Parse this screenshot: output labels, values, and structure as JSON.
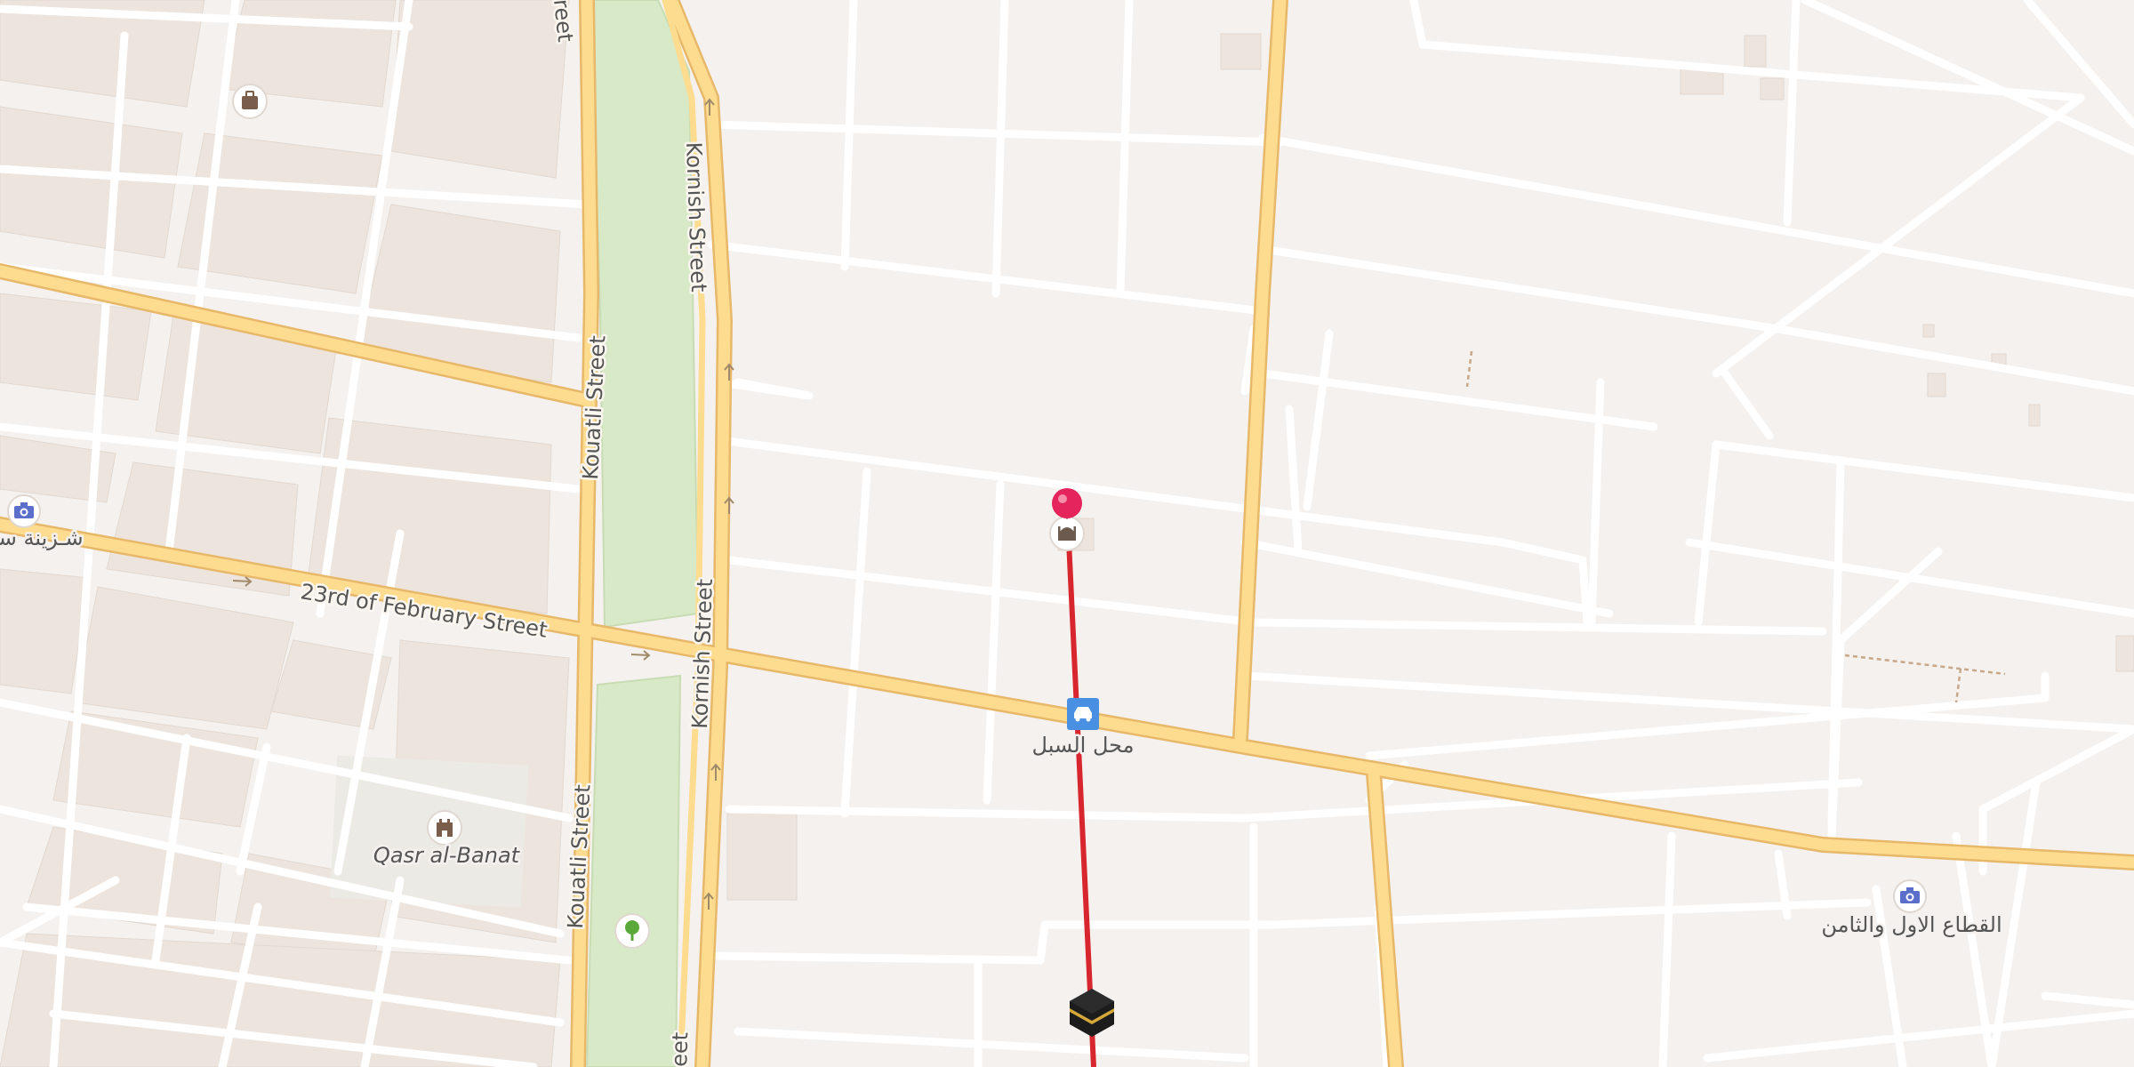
{
  "map": {
    "streets": {
      "kornish_upper": "Kornish Street",
      "kornish_lower": "Kornish Street",
      "kornish_bottom": "eet",
      "kouatli_upper": "Kouatli Street",
      "kouatli_lower": "Kouatli Street",
      "kouatli_top": "reet",
      "feb23": "23rd of February Street"
    },
    "places": {
      "qasr_al_banat": "Qasr al-Banat",
      "parking_label": "محل السبل",
      "sector_label": "القطاع الاول والثامن",
      "west_label": "شـزينة سيارة"
    },
    "icons": {
      "photo_west": "camera-icon",
      "photo_east": "camera-icon",
      "castle": "castle-icon",
      "park": "tree-icon",
      "hotel": "luggage-icon",
      "mosque": "mosque-icon",
      "parking": "car-icon",
      "kaaba": "kaaba-icon",
      "pin": "location-pin-icon"
    },
    "colors": {
      "land": "#f4f1ee",
      "block": "#ede8e3",
      "minor_road": "#ffffff",
      "major_road": "#fddc8f",
      "major_road_casing": "#e8b86a",
      "park": "#d8e9c8",
      "qibla_line": "#d8262e",
      "pin": "#e4245a",
      "poi_blue": "#5b6ec9",
      "parking_blue": "#4a90e2",
      "tree_green": "#5aa83a"
    }
  }
}
